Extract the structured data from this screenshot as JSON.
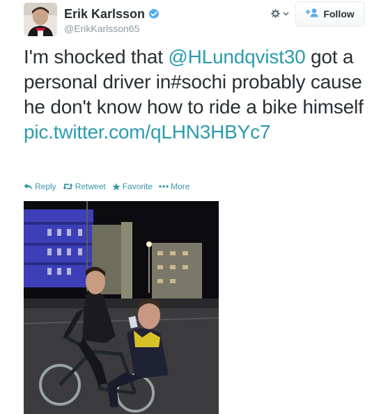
{
  "user": {
    "full_name": "Erik Karlsson",
    "screen_name": "@ErikKarlsson65",
    "avatar_icon": "player-avatar",
    "verified_icon": "verified-badge-icon"
  },
  "toolbar": {
    "gear_icon": "gear-icon",
    "follow_label": "Follow"
  },
  "tweet": {
    "text_before": "I'm shocked that ",
    "mention": "@HLundqvist30",
    "text_after": " got a personal driver in#sochi probably cause he don't know how to ride a bike himself",
    "link": "pic.twitter.com/qLHN3HBYc7"
  },
  "actions": {
    "reply": "Reply",
    "retweet": "Retweet",
    "favorite": "Favorite",
    "more": "More"
  },
  "colors": {
    "link": "#2a9cad",
    "verified": "#55acee",
    "action": "#3a96a8"
  }
}
